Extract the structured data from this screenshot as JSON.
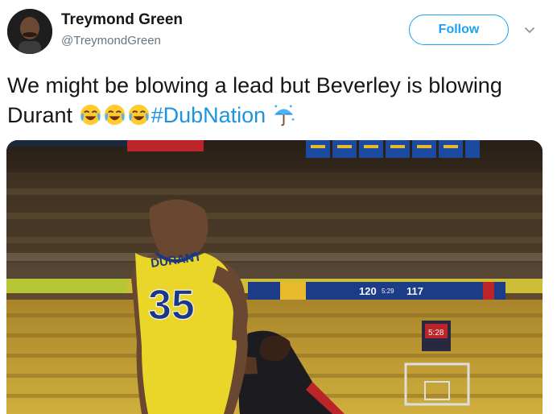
{
  "user": {
    "name": "Treymond Green",
    "handle": "@TreymondGreen",
    "avatar_icon": "profile-avatar"
  },
  "follow": {
    "label": "Follow",
    "color": "#1da1f2"
  },
  "menu": {
    "icon": "chevron-down-icon"
  },
  "tweet": {
    "text": "We might be blowing a lead but Beverley is blowing Durant",
    "emoji_icon": "face-with-tears-of-joy-emoji",
    "emoji_count": 3,
    "hashtag": "#DubNation",
    "hashtag_emoji_icon": "umbrella-with-rain-drops-emoji",
    "hashtag_color": "#1b95e0"
  },
  "media": {
    "jersey_name": "DURANT",
    "jersey_number": "35",
    "score_home": "120",
    "score_away": "117",
    "clock": "5:29",
    "shot_clock": "5:28"
  }
}
